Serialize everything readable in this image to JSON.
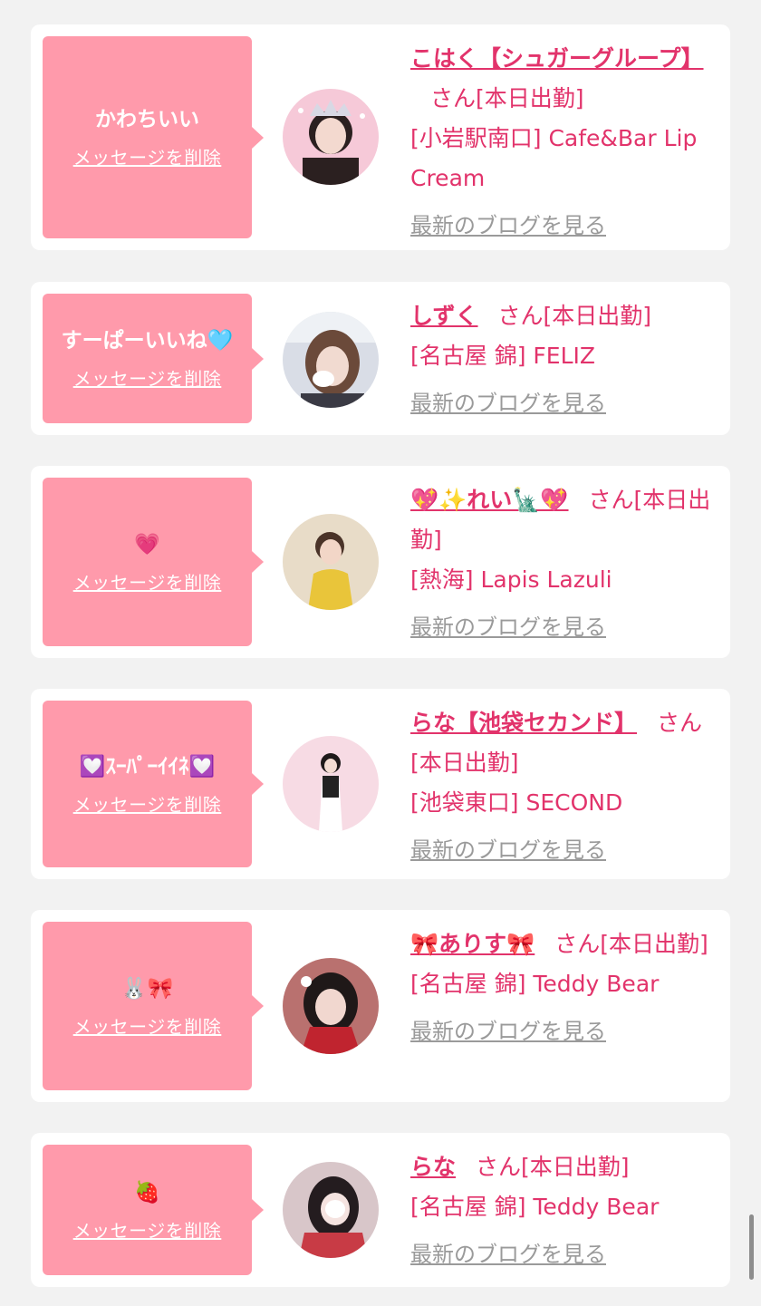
{
  "entries": [
    {
      "message": "かわちいい",
      "delete_label": "メッセージを削除",
      "name": "こはく【シュガーグループ】",
      "san": "さん",
      "status": "[本日出勤]",
      "shop": "[小岩駅南口] Cafe&Bar Lip Cream",
      "blog_label": "最新のブログを見る",
      "avatar_bg": "#f6c9d8"
    },
    {
      "message": "すーぱーいいね🩵",
      "delete_label": "メッセージを削除",
      "name": "しずく",
      "san": "さん",
      "status": "[本日出勤]",
      "shop": "[名古屋 錦] FELIZ",
      "blog_label": "最新のブログを見る",
      "avatar_bg": "#d9dde6"
    },
    {
      "message": "💗",
      "delete_label": "メッセージを削除",
      "name": "💖✨れい🗽💖",
      "san": "さん",
      "status": "[本日出勤]",
      "shop": "[熱海] Lapis Lazuli",
      "blog_label": "最新のブログを見る",
      "avatar_bg": "#e8dcc8"
    },
    {
      "message": "💟ｽｰﾊﾟｰｲｲﾈ💟",
      "delete_label": "メッセージを削除",
      "name": "らな【池袋セカンド】",
      "san": "さん",
      "status": "[本日出勤]",
      "shop": "[池袋東口] SECOND",
      "blog_label": "最新のブログを見る",
      "avatar_bg": "#f7dbe4"
    },
    {
      "message": "🐰🎀",
      "delete_label": "メッセージを削除",
      "name": "🎀ありす🎀",
      "san": "さん",
      "status": "[本日出勤]",
      "shop": "[名古屋 錦] Teddy Bear",
      "blog_label": "最新のブログを見る",
      "avatar_bg": "#b9716f"
    },
    {
      "message": "🍓",
      "delete_label": "メッセージを削除",
      "name": "らな",
      "san": "さん",
      "status": "[本日出勤]",
      "shop": "[名古屋 錦] Teddy Bear",
      "blog_label": "最新のブログを見る",
      "avatar_bg": "#d8c6c9"
    }
  ],
  "colors": {
    "accent": "#e2336b",
    "bubble": "#ff9aab",
    "link_gray": "#9a9a9a",
    "page_bg": "#f2f2f2"
  }
}
